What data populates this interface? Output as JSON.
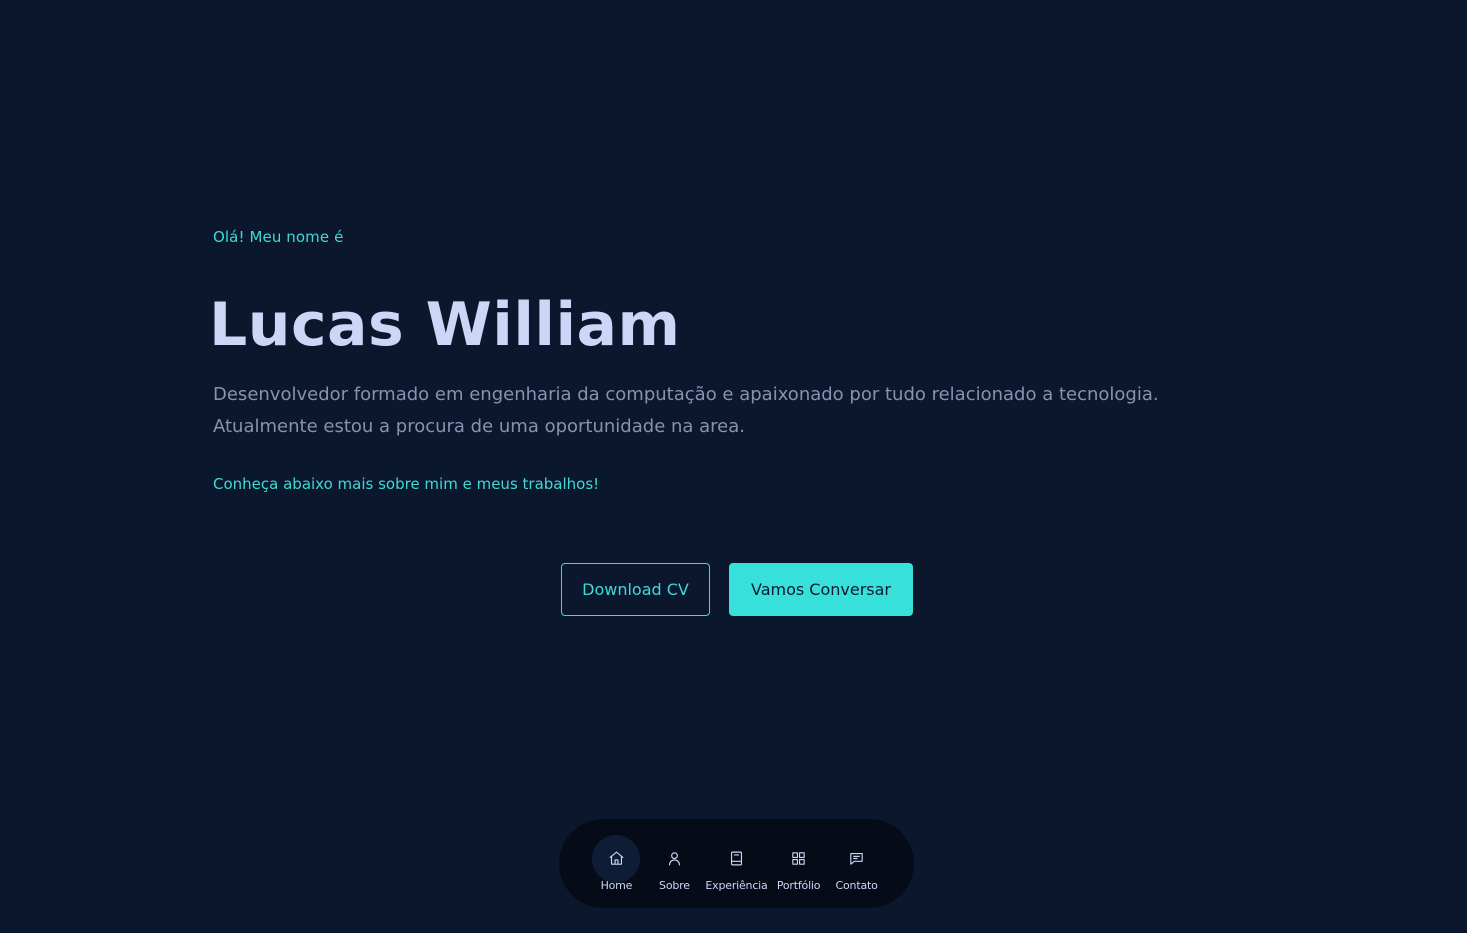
{
  "hero": {
    "greeting": "Olá! Meu nome é",
    "name": "Lucas William",
    "description_line1": "Desenvolvedor formado em engenharia da computação e apaixonado por tudo relacionado a tecnologia.",
    "description_line2": "Atualmente estou a procura de uma oportunidade na area.",
    "cta_text": "Conheça abaixo mais sobre mim e meus trabalhos!"
  },
  "buttons": {
    "download_label": "Download CV",
    "talk_label": "Vamos Conversar"
  },
  "nav": {
    "items": [
      {
        "label": "Home",
        "icon": "home-icon",
        "active": true
      },
      {
        "label": "Sobre",
        "icon": "user-icon",
        "active": false
      },
      {
        "label": "Experiência",
        "icon": "book-icon",
        "active": false
      },
      {
        "label": "Portfólio",
        "icon": "grid-icon",
        "active": false
      },
      {
        "label": "Contato",
        "icon": "message-icon",
        "active": false
      }
    ]
  },
  "colors": {
    "background": "#0a172d",
    "accent": "#3fd9d6",
    "heading": "#ccd6f6",
    "body_text": "#8892b0",
    "nav_background": "#050c18"
  }
}
